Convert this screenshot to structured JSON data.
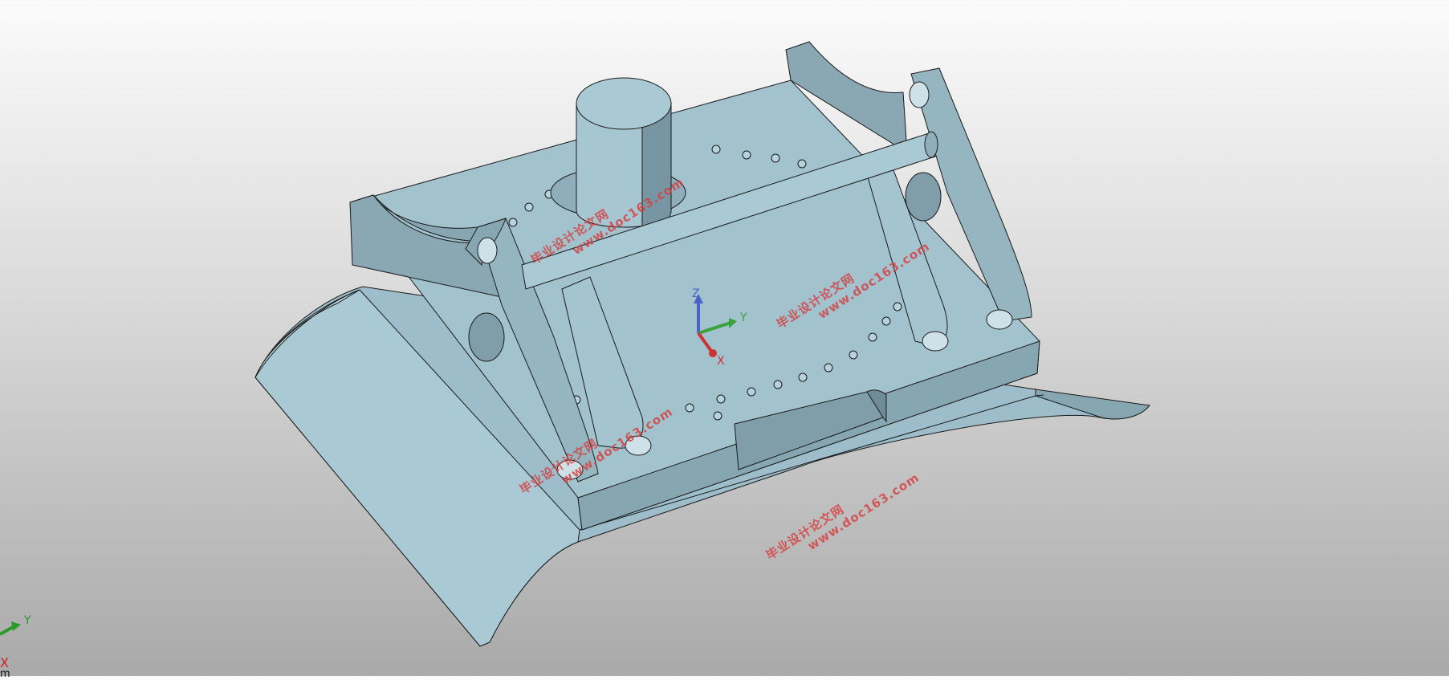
{
  "viewport": {
    "background_top": "#fbfbfb",
    "background_bottom": "#a9a9a9",
    "model_color": "#9cbdc9",
    "model_shade": "#7f9eaa",
    "model_light": "#b6d2dc",
    "edge_color": "#1a1a1a"
  },
  "model_triad": {
    "z_label": "Z",
    "y_label": "Y",
    "x_label": "X"
  },
  "view_triad": {
    "y_label": "Y",
    "x_label": "X",
    "partial_label": "m"
  },
  "watermark": {
    "color": "#d63c3c",
    "items": [
      {
        "cn": "毕业设计论文网",
        "url": "www.doc163.com"
      },
      {
        "cn": "毕业设计论文网",
        "url": "www.doc163.com"
      },
      {
        "cn": "毕业设计论文网",
        "url": "www.doc163.com"
      },
      {
        "cn": "毕业设计论文网",
        "url": "www.doc163.com"
      }
    ]
  }
}
